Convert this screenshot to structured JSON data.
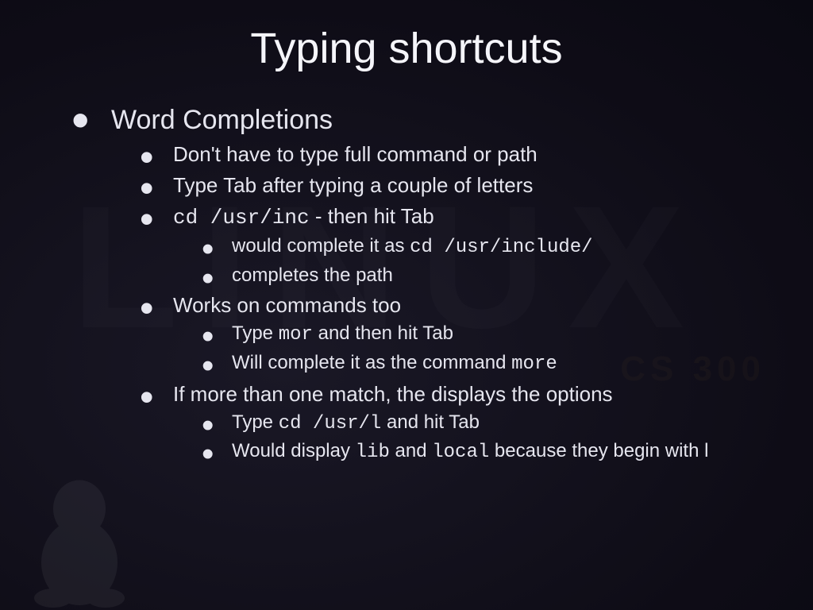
{
  "watermark": {
    "big": "LINUX",
    "sub": "CS 300"
  },
  "title": "Typing shortcuts",
  "l0": {
    "label": "Word Completions"
  },
  "l1": {
    "a": "Don't have to type full command or path",
    "b": "Type Tab after typing a couple of letters",
    "c": {
      "pre": "cd /usr/inc",
      "post": " - then hit Tab"
    },
    "d": "Works on commands too",
    "e": "If more than one match, the displays the options"
  },
  "l2": {
    "c1": {
      "pre": "would complete it as ",
      "code": "cd /usr/include/"
    },
    "c2": "completes the path",
    "d1": {
      "pre": "Type ",
      "code": "mor",
      "post": " and then hit Tab"
    },
    "d2": {
      "pre": "Will complete it as the command ",
      "code": "more"
    },
    "e1": {
      "pre": "Type ",
      "code": "cd /usr/l",
      "post": " and hit Tab"
    },
    "e2": {
      "pre": "Would display ",
      "code1": "lib",
      "mid": " and ",
      "code2": "local",
      "post": " because they begin with l"
    }
  }
}
